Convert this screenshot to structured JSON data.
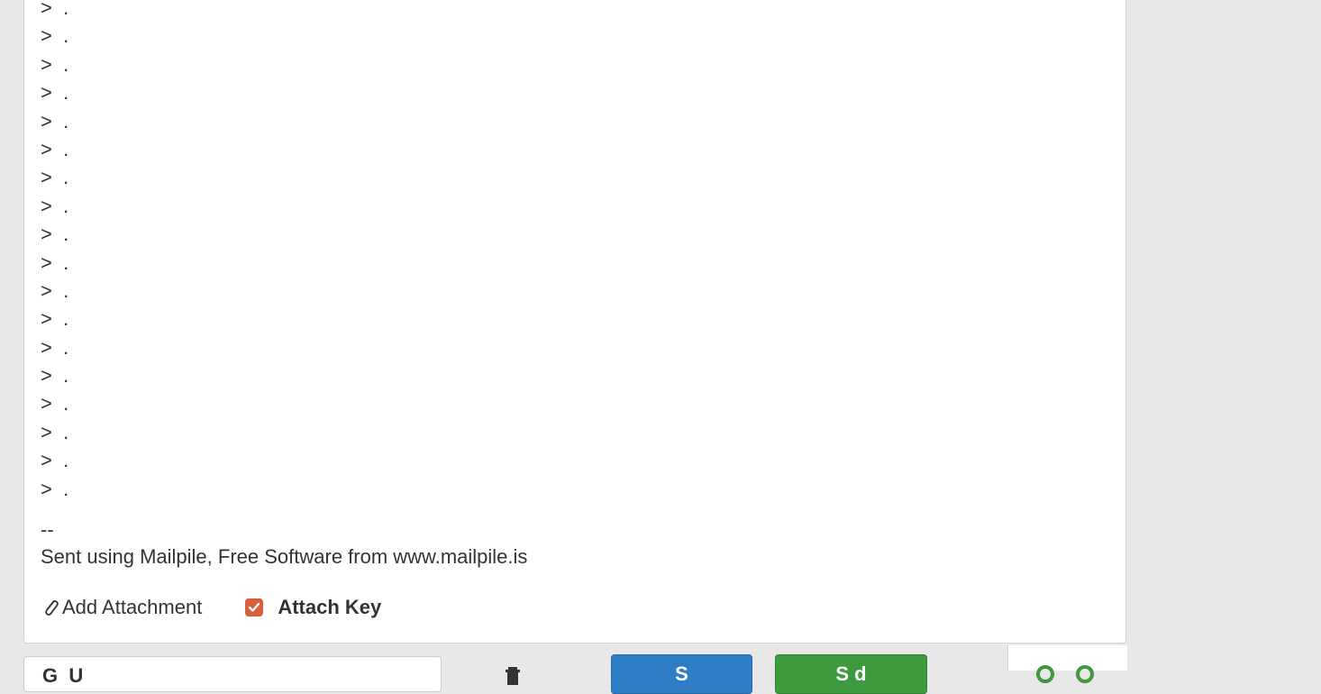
{
  "message": {
    "quote_lines": [
      ">  .",
      ">  .",
      ">  .",
      ">  .",
      ">  .",
      ">  .",
      ">  .",
      ">  .",
      ">  .",
      ">  .",
      ">  .",
      ">  .",
      ">  .",
      ">  .",
      ">  .",
      ">  .",
      ">  .",
      ">  ."
    ],
    "signature_separator": "--",
    "signature_text": "Sent using Mailpile, Free Software from www.mailpile.is"
  },
  "attachments": {
    "add_label": "Add Attachment",
    "attach_key_label": "Attach Key",
    "attach_key_checked": true
  },
  "toolbar": {
    "from_partial": "G  U",
    "save_partial": "S",
    "send_partial": "S  d"
  },
  "colors": {
    "checkbox": "#d6613a",
    "save": "#2f7dc4",
    "send": "#3e9a3e"
  },
  "icons": {
    "attachment": "paperclip-icon",
    "checkbox": "checkbox-checked-icon",
    "trash": "trash-icon",
    "save": "save-icon",
    "send": "send-icon"
  }
}
